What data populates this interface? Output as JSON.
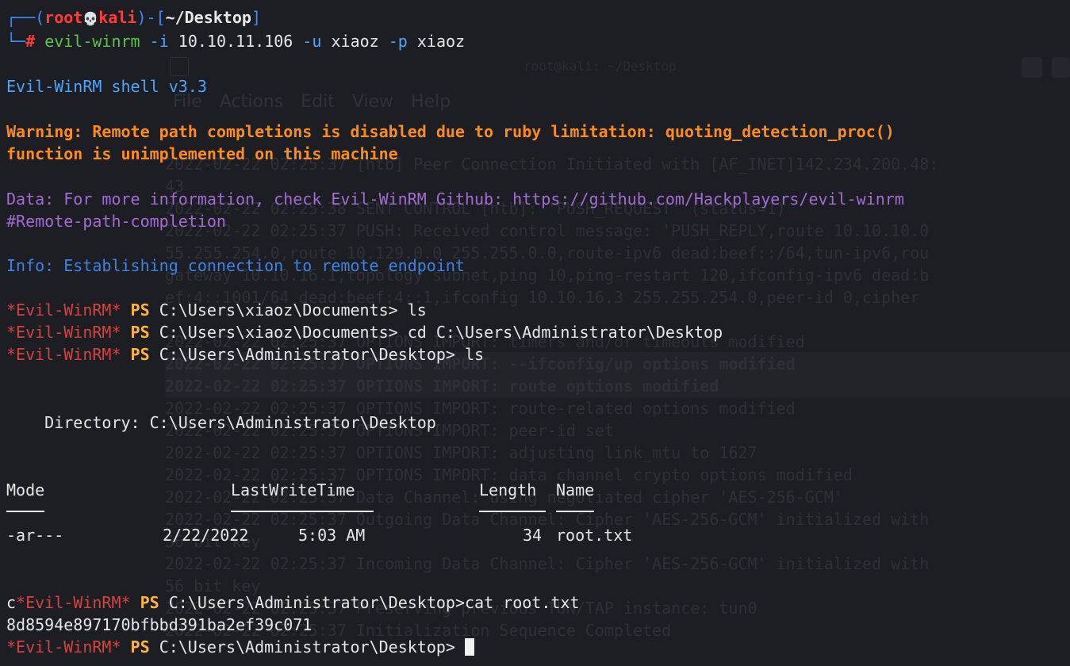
{
  "ghost": {
    "title": "root@kali: ~/Desktop",
    "menu": [
      "File",
      "Actions",
      "Edit",
      "View",
      "Help"
    ],
    "lines": [
      "2022-02-22 02:25:37 [htb] Peer Connection Initiated with [AF_INET]142.234.200.48:",
      "43",
      "2022-02-22 02:25:38 SENT CONTROL [htb]: 'PUSH_REQUEST' (status=1)",
      "2022-02-22 02:25:37 PUSH: Received control message: 'PUSH_REPLY,route 10.10.10.0",
      "55.255.254.0,route 10.129.0.0 255.255.0.0,route-ipv6 dead:beef::/64,tun-ipv6,rou",
      "gateway 10.10.16.1,topology subnet,ping 10,ping-restart 120,ifconfig-ipv6 dead:b",
      "ef:4::1001/64 dead:beef:4::1,ifconfig 10.10.16.3 255.255.254.0,peer-id 0,cipher",
      "",
      "2022-02-22 02:25:37 OPTIONS IMPORT: timers and/or timeouts modified",
      "2022-02-22 02:25:37 OPTIONS IMPORT: --ifconfig/up options modified",
      "2022-02-22 02:25:37 OPTIONS IMPORT: route options modified",
      "2022-02-22 02:25:37 OPTIONS IMPORT: route-related options modified",
      "2022-02-22 02:25:37 OPTIONS IMPORT: peer-id set",
      "2022-02-22 02:25:37 OPTIONS IMPORT: adjusting link_mtu to 1627",
      "2022-02-22 02:25:37 OPTIONS IMPORT: data channel crypto options modified",
      "2022-02-22 02:25:37 Data Channel: using negotiated cipher 'AES-256-GCM'",
      "2022-02-22 02:25:37 Outgoing Data Channel: Cipher 'AES-256-GCM' initialized with",
      "56 bit key",
      "2022-02-22 02:25:37 Incoming Data Channel: Cipher 'AES-256-GCM' initialized with",
      "56 bit key",
      "2022-02-22 02:25:37 Preserving previous TUN/TAP instance: tun0",
      "2022-02-22 02:25:37 Initialization Sequence Completed"
    ]
  },
  "prompt": {
    "user": "root",
    "skull": "💀",
    "host": "kali",
    "cwd": "~/Desktop",
    "hash": "#",
    "command_name": "evil-winrm",
    "flag_i": "-i",
    "ip": "10.10.11.106",
    "flag_u": "-u",
    "user_arg": "xiaoz",
    "flag_p": "-p",
    "pass_arg": "xiaoz"
  },
  "output": {
    "banner": "Evil-WinRM shell v3.3",
    "warning_1": "Warning: Remote path completions is disabled due to ruby limitation: quoting_detection_proc()",
    "warning_2": "function is unimplemented on this machine",
    "data_1": "Data: For more information, check Evil-WinRM Github: https://github.com/Hackplayers/evil-winrm",
    "data_2": "#Remote-path-completion",
    "info": "Info: Establishing connection to remote endpoint"
  },
  "ps_prompt": {
    "tag": "*Evil-WinRM*",
    "ps": "PS"
  },
  "commands": [
    {
      "path": "C:\\Users\\xiaoz\\Documents>",
      "cmd": " ls"
    },
    {
      "path": "C:\\Users\\xiaoz\\Documents>",
      "cmd": " cd C:\\Users\\Administrator\\Desktop"
    },
    {
      "path": "C:\\Users\\Administrator\\Desktop>",
      "cmd": " ls"
    }
  ],
  "listing": {
    "directory_line": "    Directory: C:\\Users\\Administrator\\Desktop",
    "headers": {
      "mode": "Mode",
      "lastwrite": "LastWriteTime",
      "length": "Length",
      "name": "Name"
    },
    "rows": [
      {
        "mode": "-ar---",
        "date": "2/22/2022",
        "time": "5:03 AM",
        "length": "34",
        "name": "root.txt"
      }
    ]
  },
  "cat_command": {
    "prefix": "c",
    "path": "C:\\Users\\Administrator\\Desktop>",
    "cmd": "cat root.txt"
  },
  "flag_output": "8d8594e897170bfbbd391ba2ef39c071",
  "final_prompt": {
    "path": "C:\\Users\\Administrator\\Desktop>"
  },
  "colors": {
    "background": "#1c1e24",
    "blue": "#4aa5ff",
    "orange": "#ff8c1a",
    "purple": "#a46ad6",
    "red": "#d6423f",
    "ps_yellow": "#ffb43a"
  }
}
